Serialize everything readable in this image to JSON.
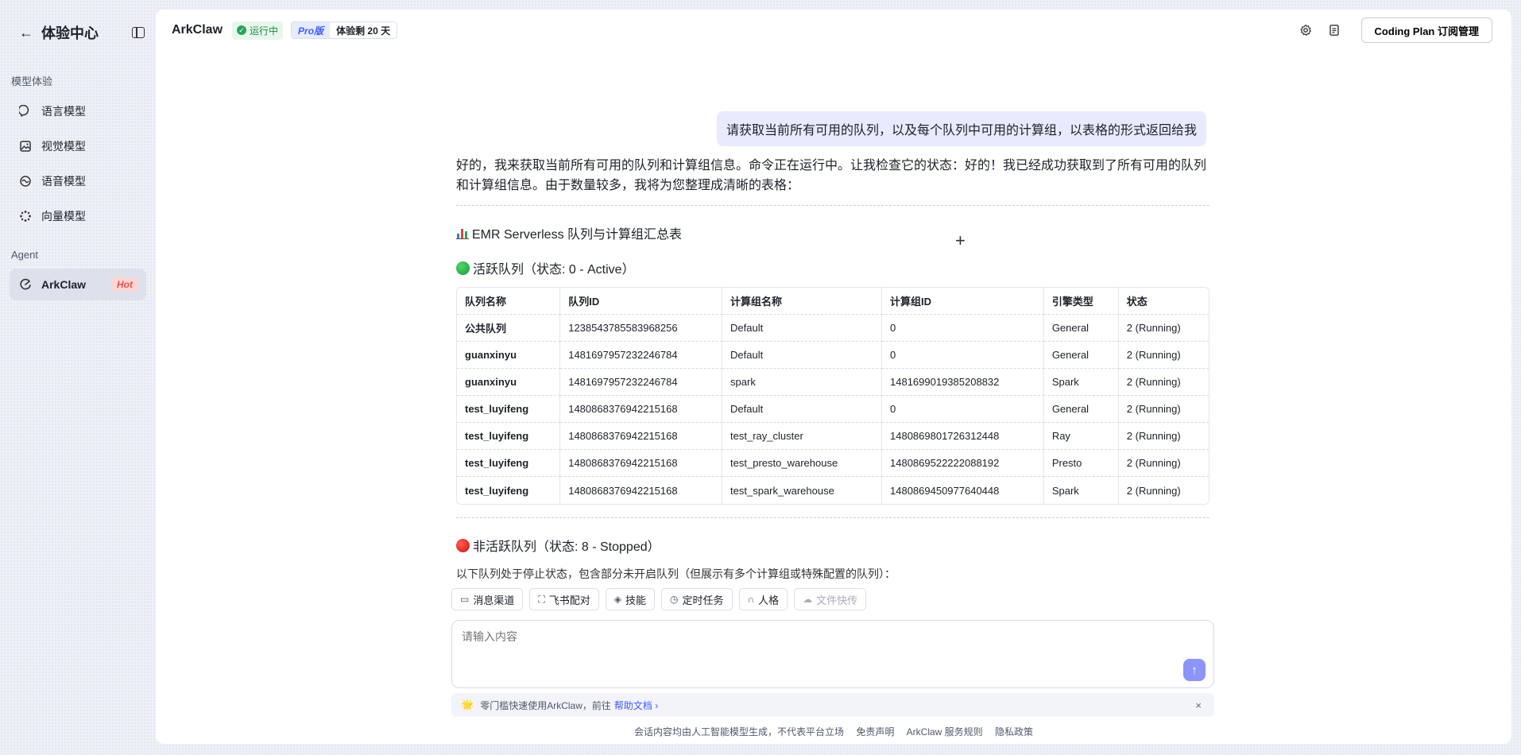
{
  "sidebar": {
    "title": "体验中心",
    "section_models": "模型体验",
    "items": [
      {
        "label": "语言模型"
      },
      {
        "label": "视觉模型"
      },
      {
        "label": "语音模型"
      },
      {
        "label": "向量模型"
      }
    ],
    "section_agent": "Agent",
    "agent_item": {
      "label": "ArkClaw",
      "badge": "Hot"
    }
  },
  "header": {
    "app_name": "ArkClaw",
    "status": "运行中",
    "plan": "Pro版",
    "trial": "体验剩 20 天",
    "plan_button": "Coding Plan 订阅管理"
  },
  "chat": {
    "user_message": "请获取当前所有可用的队列，以及每个队列中可用的计算组，以表格的形式返回给我",
    "reply_intro": "好的，我来获取当前所有可用的队列和计算组信息。命令正在运行中。让我检查它的状态：好的！我已经成功获取到了所有可用的队列和计算组信息。由于数量较多，我将为您整理成清晰的表格：",
    "summary_title": "EMR Serverless 队列与计算组汇总表",
    "active_title": "活跃队列（状态: 0 - Active）",
    "table": {
      "headers": [
        "队列名称",
        "队列ID",
        "计算组名称",
        "计算组ID",
        "引擎类型",
        "状态"
      ],
      "rows": [
        [
          "公共队列",
          "1238543785583968256",
          "Default",
          "0",
          "General",
          "2 (Running)"
        ],
        [
          "guanxinyu",
          "1481697957232246784",
          "Default",
          "0",
          "General",
          "2 (Running)"
        ],
        [
          "guanxinyu",
          "1481697957232246784",
          "spark",
          "1481699019385208832",
          "Spark",
          "2 (Running)"
        ],
        [
          "test_luyifeng",
          "1480868376942215168",
          "Default",
          "0",
          "General",
          "2 (Running)"
        ],
        [
          "test_luyifeng",
          "1480868376942215168",
          "test_ray_cluster",
          "1480869801726312448",
          "Ray",
          "2 (Running)"
        ],
        [
          "test_luyifeng",
          "1480868376942215168",
          "test_presto_warehouse",
          "1480869522222088192",
          "Presto",
          "2 (Running)"
        ],
        [
          "test_luyifeng",
          "1480868376942215168",
          "test_spark_warehouse",
          "1480869450977640448",
          "Spark",
          "2 (Running)"
        ]
      ]
    },
    "inactive_title": "非活跃队列（状态: 8 - Stopped）",
    "inactive_desc": "以下队列处于停止状态，包含部分未开启队列（但展示有多个计算组或特殊配置的队列）："
  },
  "toolbar": {
    "chips": [
      "消息渠道",
      "飞书配对",
      "技能",
      "定时任务",
      "人格",
      "文件快传"
    ]
  },
  "composer": {
    "placeholder": "请输入内容"
  },
  "tip": {
    "text": "零门槛快速使用ArkClaw，前往",
    "link": "帮助文档"
  },
  "footer": {
    "notice": "会话内容均由人工智能模型生成，不代表平台立场",
    "disclaimer": "免责声明",
    "rules": "ArkClaw 服务规则",
    "privacy": "隐私政策"
  },
  "colors": {
    "accent": "#3d5afe",
    "user_bubble": "#e8eafd",
    "send_button": "#8c95f7",
    "hot_badge": "#e8534d",
    "status_green": "#23a55a"
  }
}
